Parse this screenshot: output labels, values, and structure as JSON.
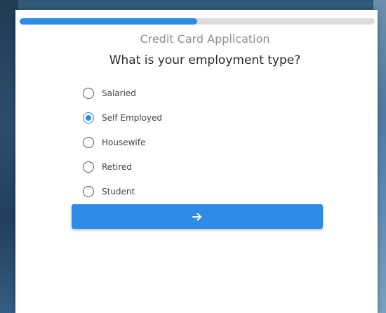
{
  "progress": {
    "value": 0.5
  },
  "form": {
    "title": "Credit Card Application",
    "question": "What is your employment type?",
    "options": [
      {
        "label": "Salaried",
        "selected": false
      },
      {
        "label": "Self Employed",
        "selected": true
      },
      {
        "label": "Housewife",
        "selected": false
      },
      {
        "label": "Retired",
        "selected": false
      },
      {
        "label": "Student",
        "selected": false
      }
    ],
    "next_button": {
      "icon": "arrow-right-icon"
    }
  },
  "colors": {
    "accent": "#2e8be6",
    "progress_track": "#dcdcdc"
  }
}
